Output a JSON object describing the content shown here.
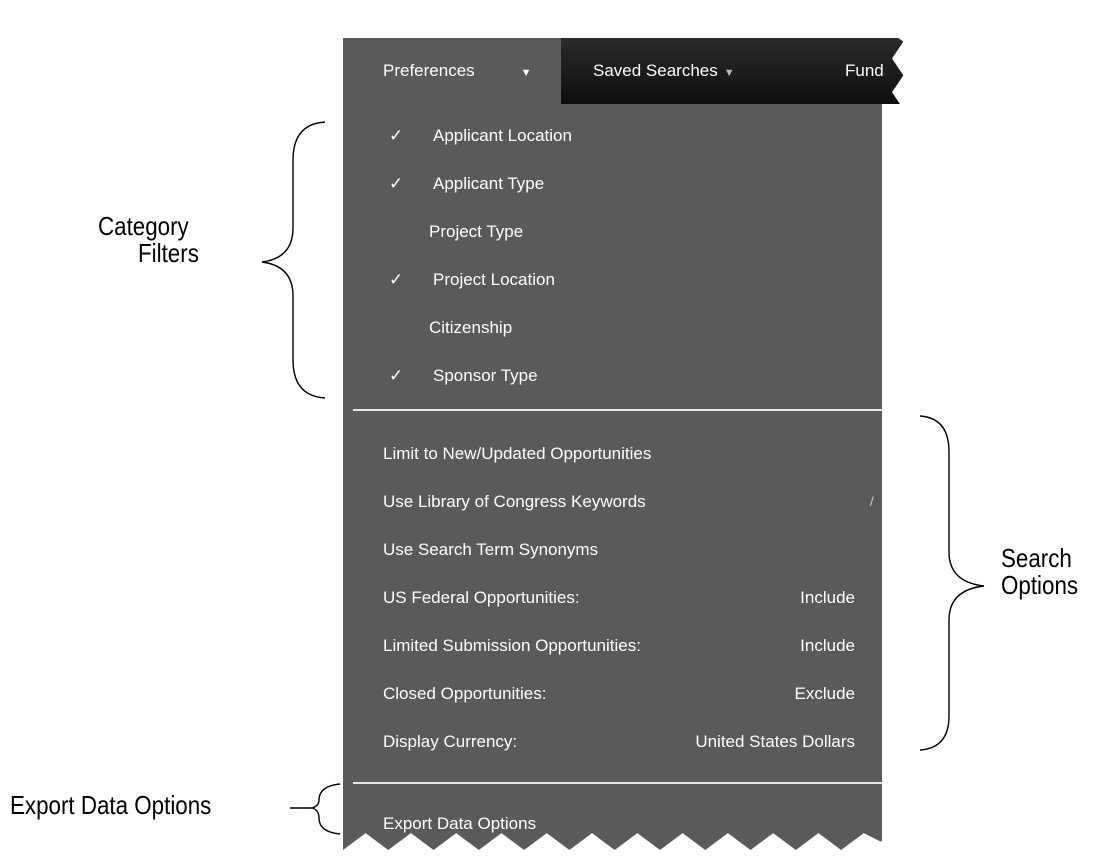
{
  "nav": {
    "preferences_label": "Preferences",
    "saved_searches_label": "Saved Searches",
    "funding_label_partial": "Fund"
  },
  "category_filters": [
    {
      "label": "Applicant Location",
      "checked": true
    },
    {
      "label": "Applicant Type",
      "checked": true
    },
    {
      "label": "Project Type",
      "checked": false
    },
    {
      "label": "Project Location",
      "checked": true
    },
    {
      "label": "Citizenship",
      "checked": false
    },
    {
      "label": "Sponsor Type",
      "checked": true
    }
  ],
  "check_glyph": "✓",
  "search_options": [
    {
      "label": "Limit to New/Updated Opportunities",
      "value": ""
    },
    {
      "label": "Use Library of Congress Keywords",
      "value": ""
    },
    {
      "label": "Use Search Term Synonyms",
      "value": ""
    },
    {
      "label": "US Federal Opportunities:",
      "value": "Include"
    },
    {
      "label": "Limited Submission Opportunities:",
      "value": "Include"
    },
    {
      "label": "Closed Opportunities:",
      "value": "Exclude"
    },
    {
      "label": "Display Currency:",
      "value": "United States Dollars"
    }
  ],
  "export_item": "Export Data Options",
  "annotations": {
    "category_line1": "Category",
    "category_line2": "Filters",
    "search_line1": "Search",
    "search_line2": "Options",
    "export": "Export Data Options"
  },
  "colors": {
    "menu_bg": "#5a5a5a",
    "navbar_bg": "#1a1a1a",
    "menu_text": "#ffffff",
    "separator": "#e6e6e6"
  }
}
